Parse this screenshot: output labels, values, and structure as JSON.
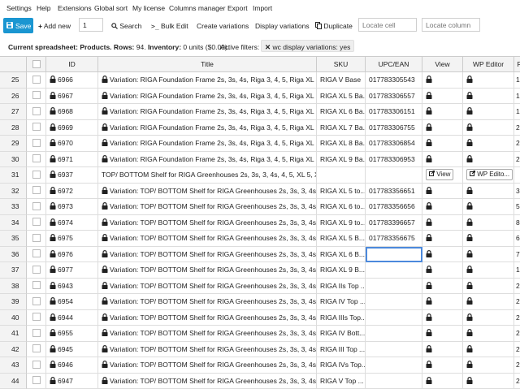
{
  "menu": [
    "Settings",
    "Help",
    "Extensions",
    "Global sort",
    "My license",
    "Columns manager",
    "Export",
    "Import"
  ],
  "toolbar": {
    "save": "Save",
    "add_new": "Add new",
    "add_count": "1",
    "search": "Search",
    "bulk_edit": "Bulk Edit",
    "create_variations": "Create variations",
    "display_variations": "Display variations",
    "duplicate": "Duplicate",
    "locate_cell_placeholder": "Locate cell",
    "locate_column_placeholder": "Locate column"
  },
  "status": {
    "prefix": "Current spreadsheet: Products. ",
    "rows_label": "Rows:",
    "rows_value": " 94. ",
    "inventory_label": "Inventory:",
    "inventory_value": " 0 units ($0.00).",
    "filters_label": "Active filters:",
    "filter_chip": "wc display variations: yes"
  },
  "columns": [
    "",
    "ID",
    "Title",
    "SKU",
    "UPC/EAN",
    "View",
    "WP Editor",
    "R"
  ],
  "view_button": "View",
  "wp_edit_button": "WP Edito...",
  "rows": [
    {
      "n": "25",
      "id": "6966",
      "locked": true,
      "title": "Variation: RIGA Foundation Frame 2s, 3s, 4s, Riga 3, 4, 5, Riga XL 5, ...",
      "sku": "RIGA V Base",
      "upc": "017783305543",
      "r": "1"
    },
    {
      "n": "26",
      "id": "6967",
      "locked": true,
      "title": "Variation: RIGA Foundation Frame 2s, 3s, 4s, Riga 3, 4, 5, Riga XL 5, ...",
      "sku": "RIGA XL 5 Ba...",
      "upc": "017783306557",
      "r": "1"
    },
    {
      "n": "27",
      "id": "6968",
      "locked": true,
      "title": "Variation: RIGA Foundation Frame 2s, 3s, 4s, Riga 3, 4, 5, Riga XL 5, ...",
      "sku": "RIGA XL 6 Ba...",
      "upc": "017783306151",
      "r": "1"
    },
    {
      "n": "28",
      "id": "6969",
      "locked": true,
      "title": "Variation: RIGA Foundation Frame 2s, 3s, 4s, Riga 3, 4, 5, Riga XL 5, ...",
      "sku": "RIGA XL 7 Ba...",
      "upc": "017783306755",
      "r": "2"
    },
    {
      "n": "29",
      "id": "6970",
      "locked": true,
      "title": "Variation: RIGA Foundation Frame 2s, 3s, 4s, Riga 3, 4, 5, Riga XL 5, ...",
      "sku": "RIGA XL 8 Ba...",
      "upc": "017783306854",
      "r": "2"
    },
    {
      "n": "30",
      "id": "6971",
      "locked": true,
      "title": "Variation: RIGA Foundation Frame 2s, 3s, 4s, Riga 3, 4, 5, Riga XL 5, ...",
      "sku": "RIGA XL 9 Ba...",
      "upc": "017783306953",
      "r": "2"
    },
    {
      "n": "31",
      "id": "6937",
      "locked": false,
      "title": "TOP/ BOTTOM Shelf for RIGA Greenhouses 2s, 3s, 3, 4s, 4, 5, XL 5, XL 6 ...",
      "sku": "",
      "upc": "",
      "r": "",
      "buttons": true
    },
    {
      "n": "32",
      "id": "6972",
      "locked": true,
      "title": "Variation: TOP/ BOTTOM Shelf for RIGA Greenhouses 2s, 3s, 3, 4s, 4 ...",
      "sku": "RIGA XL 5 to...",
      "upc": "017783356651",
      "r": "3"
    },
    {
      "n": "33",
      "id": "6973",
      "locked": true,
      "title": "Variation: TOP/ BOTTOM Shelf for RIGA Greenhouses 2s, 3s, 3, 4s, 4 ...",
      "sku": "RIGA XL 6 to...",
      "upc": "017783356656",
      "r": "5"
    },
    {
      "n": "34",
      "id": "6974",
      "locked": true,
      "title": "Variation: TOP/ BOTTOM Shelf for RIGA Greenhouses 2s, 3s, 3, 4s, 4 ...",
      "sku": "RIGA XL 9 to...",
      "upc": "017783396657",
      "r": "8"
    },
    {
      "n": "35",
      "id": "6975",
      "locked": true,
      "title": "Variation: TOP/ BOTTOM Shelf for RIGA Greenhouses 2s, 3s, 3, 4s, 4 ...",
      "sku": "RIGA XL 5 B...",
      "upc": "017783356675",
      "r": "6"
    },
    {
      "n": "36",
      "id": "6976",
      "locked": true,
      "title": "Variation: TOP/ BOTTOM Shelf for RIGA Greenhouses 2s, 3s, 3, 4s, 4 ...",
      "sku": "RIGA XL 6 B...",
      "upc": "",
      "r": "7",
      "selected": true
    },
    {
      "n": "37",
      "id": "6977",
      "locked": true,
      "title": "Variation: TOP/ BOTTOM Shelf for RIGA Greenhouses 2s, 3s, 3, 4s, 4 ...",
      "sku": "RIGA XL 9 B...",
      "upc": "",
      "r": "1"
    },
    {
      "n": "38",
      "id": "6943",
      "locked": true,
      "title": "Variation: TOP/ BOTTOM Shelf for RIGA Greenhouses 2s, 3s, 3, 4s, 4 ...",
      "sku": "RIGA IIs Top ...",
      "upc": "",
      "r": "2"
    },
    {
      "n": "39",
      "id": "6954",
      "locked": true,
      "title": "Variation: TOP/ BOTTOM Shelf for RIGA Greenhouses 2s, 3s, 3, 4s, 4 ...",
      "sku": "RIGA IV Top ...",
      "upc": "",
      "r": "2"
    },
    {
      "n": "40",
      "id": "6944",
      "locked": true,
      "title": "Variation: TOP/ BOTTOM Shelf for RIGA Greenhouses 2s, 3s, 3, 4s, 4 ...",
      "sku": "RIGA IIIs Top...",
      "upc": "",
      "r": "2"
    },
    {
      "n": "41",
      "id": "6955",
      "locked": true,
      "title": "Variation: TOP/ BOTTOM Shelf for RIGA Greenhouses 2s, 3s, 3, 4s, 4 ...",
      "sku": "RIGA IV Bott...",
      "upc": "",
      "r": "2"
    },
    {
      "n": "42",
      "id": "6945",
      "locked": true,
      "title": "Variation: TOP/ BOTTOM Shelf for RIGA Greenhouses 2s, 3s, 3, 4s, 4 ...",
      "sku": "RIGA III Top ...",
      "upc": "",
      "r": "2"
    },
    {
      "n": "43",
      "id": "6946",
      "locked": true,
      "title": "Variation: TOP/ BOTTOM Shelf for RIGA Greenhouses 2s, 3s, 3, 4s, 4 ...",
      "sku": "RIGA IVs Top...",
      "upc": "",
      "r": "2"
    },
    {
      "n": "44",
      "id": "6947",
      "locked": true,
      "title": "Variation: TOP/ BOTTOM Shelf for RIGA Greenhouses 2s, 3s, 3, 4s, 4 ...",
      "sku": "RIGA V Top ...",
      "upc": "",
      "r": "2"
    }
  ],
  "colors": {
    "accent": "#1a96d1",
    "selection": "#4b89dc",
    "header_bg": "#f3f3f3"
  }
}
